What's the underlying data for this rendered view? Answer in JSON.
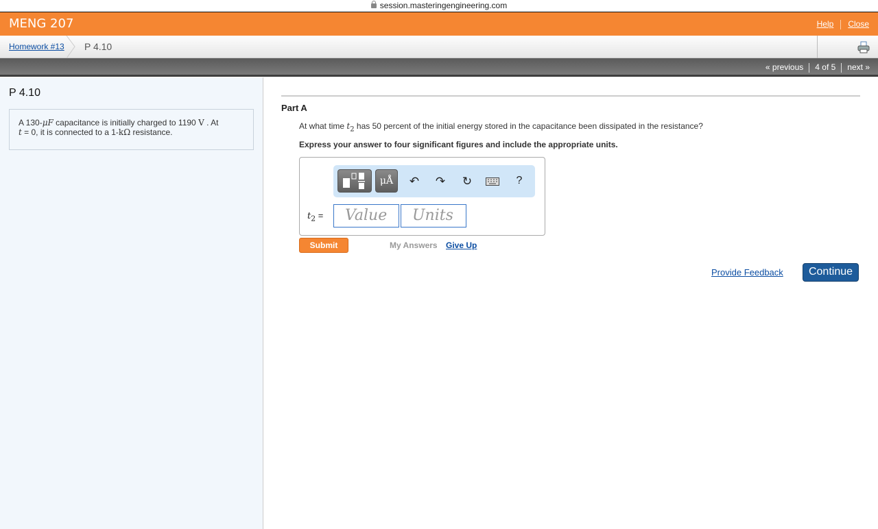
{
  "browser": {
    "url": "session.masteringengineering.com"
  },
  "header": {
    "course_title": "MENG 207",
    "help_label": "Help",
    "close_label": "Close"
  },
  "breadcrumb": {
    "homework": "Homework #13",
    "current": "P 4.10"
  },
  "nav": {
    "previous_label": "« previous",
    "position": "4 of 5",
    "next_label": "next »"
  },
  "problem": {
    "title": "P 4.10",
    "text_1": "A 130-",
    "unit_uF": "μF",
    "text_2": " capacitance is initially charged to 1190 ",
    "unit_V": "V",
    "text_3": " . At",
    "var_t": "t",
    "text_4": " = 0, it is connected to a 1-",
    "unit_kohm": "kΩ",
    "text_5": " resistance."
  },
  "part": {
    "label": "Part A",
    "question_1": "At what time ",
    "question_var": "t",
    "question_sub": "2",
    "question_2": " has 50 percent of the initial energy stored in the capacitance been dissipated in the resistance?",
    "instructions": "Express your answer to four significant figures and include the appropriate units.",
    "toolbar": {
      "units_button": "μÅ",
      "help_button": "?"
    },
    "answer_label_var": "t",
    "answer_label_sub": "2",
    "answer_label_eq": " =",
    "value_placeholder": "Value",
    "units_placeholder": "Units",
    "submit_label": "Submit",
    "my_answers_label": "My Answers",
    "give_up_label": "Give Up"
  },
  "footer": {
    "feedback_label": "Provide Feedback",
    "continue_label": "Continue"
  }
}
